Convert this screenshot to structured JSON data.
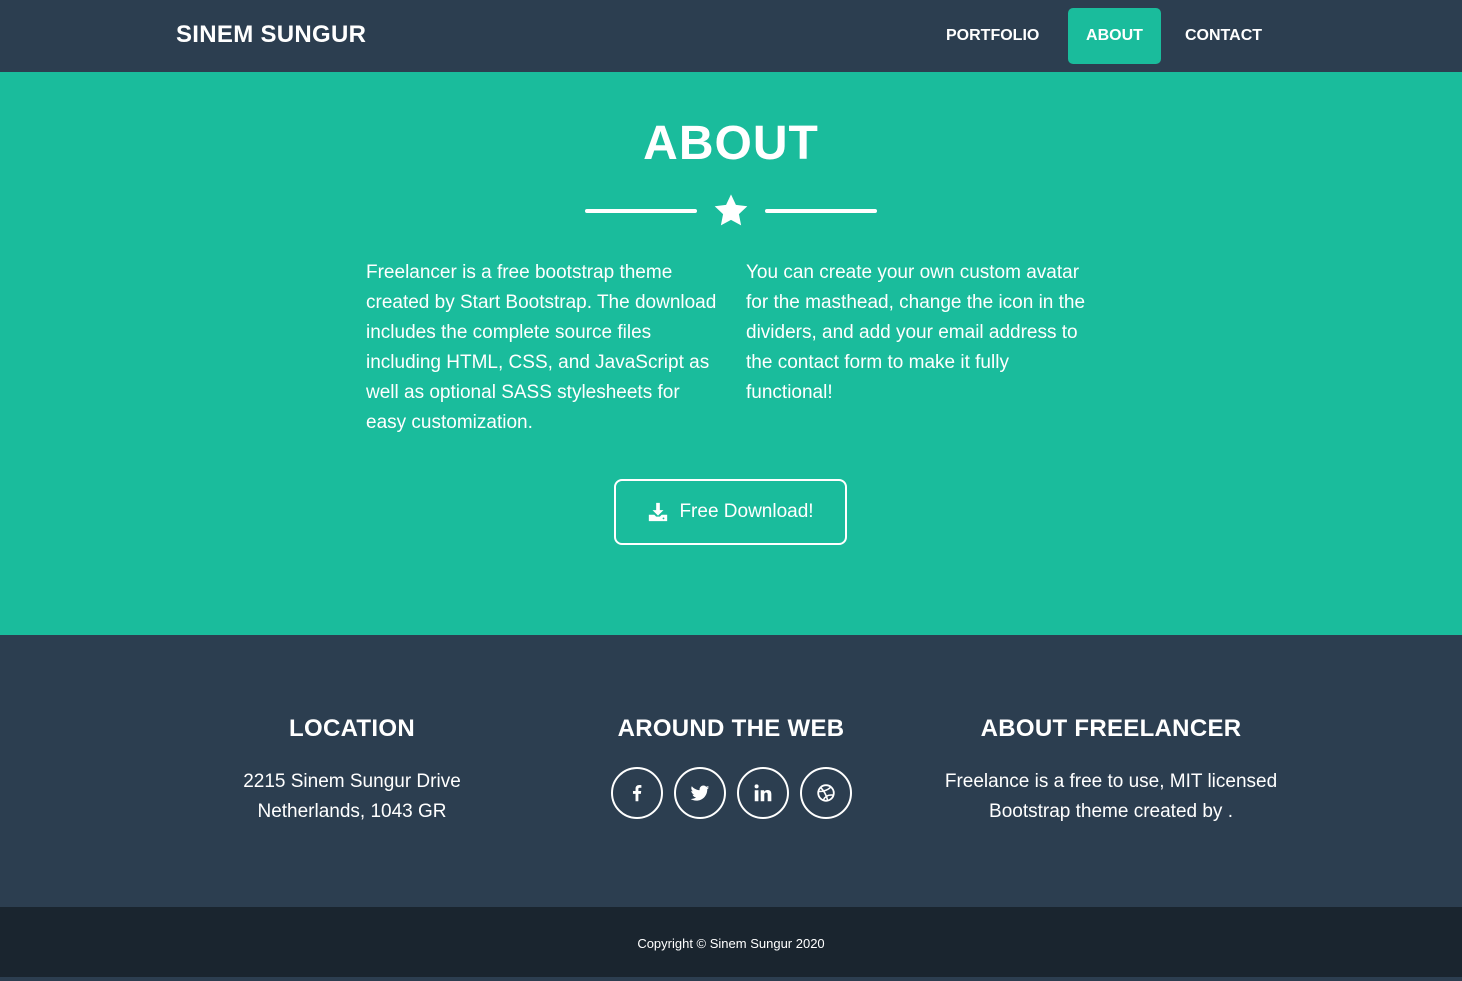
{
  "nav": {
    "brand": "SINEM SUNGUR",
    "items": [
      {
        "label": "PORTFOLIO",
        "active": false
      },
      {
        "label": "ABOUT",
        "active": true
      },
      {
        "label": "CONTACT",
        "active": false
      }
    ]
  },
  "about": {
    "title": "ABOUT",
    "divider_icon": "star-icon",
    "left_text": "Freelancer is a free bootstrap theme created by Start Bootstrap. The download includes the complete source files including HTML, CSS, and JavaScript as well as optional SASS stylesheets for easy customization.",
    "right_text": "You can create your own custom avatar for the masthead, change the icon in the dividers, and add your email address to the contact form to make it fully functional!",
    "download_label": "Free Download!",
    "download_icon": "download-icon"
  },
  "footer": {
    "location": {
      "heading": "LOCATION",
      "line1": "2215 Sinem Sungur Drive",
      "line2": "Netherlands, 1043 GR"
    },
    "web": {
      "heading": "AROUND THE WEB",
      "icons": [
        "facebook-icon",
        "twitter-icon",
        "linkedin-icon",
        "dribbble-icon"
      ]
    },
    "about": {
      "heading": "ABOUT FREELANCER",
      "line1": "Freelance is a free to use, MIT licensed",
      "line2": "Bootstrap theme created by ."
    }
  },
  "copyright": "Copyright © Sinem Sungur 2020",
  "colors": {
    "primary": "#1abc9c",
    "secondary": "#2c3e50",
    "dark": "#1a252f"
  }
}
